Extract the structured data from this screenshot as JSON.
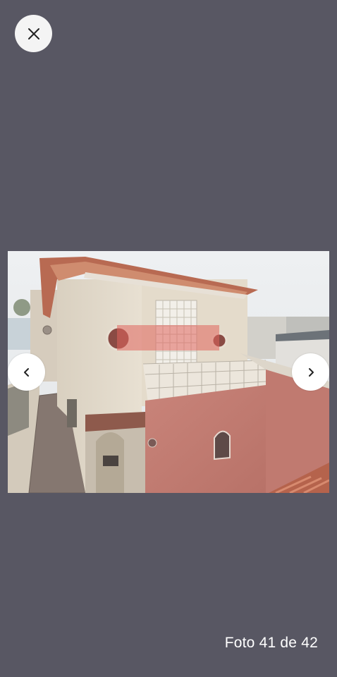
{
  "viewer": {
    "background": "#585763",
    "close_icon": "close-icon",
    "prev_icon": "chevron-left-icon",
    "next_icon": "chevron-right-icon"
  },
  "photo": {
    "subject": "house-exterior-photo",
    "watermark_color": "#e0645c"
  },
  "counter": {
    "prefix": "Foto",
    "current": "41",
    "separator": "de",
    "total": "42"
  }
}
